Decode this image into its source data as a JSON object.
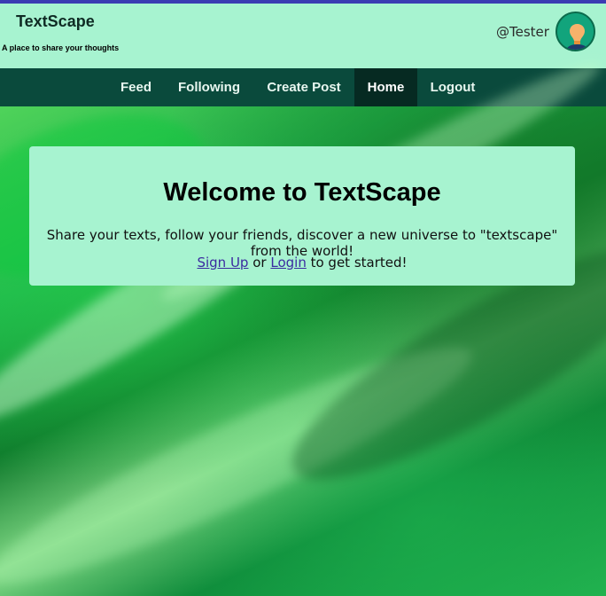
{
  "header": {
    "title": "TextScape",
    "tagline": "A place to share your thoughts",
    "username": "@Tester"
  },
  "nav": {
    "items": [
      {
        "label": "Feed",
        "active": false
      },
      {
        "label": "Following",
        "active": false
      },
      {
        "label": "Create Post",
        "active": false
      },
      {
        "label": "Home",
        "active": true
      },
      {
        "label": "Logout",
        "active": false
      }
    ]
  },
  "welcome": {
    "title": "Welcome to TextScape",
    "subtitle": "Share your texts, follow your friends, discover a new universe to \"textscape\" from the world!",
    "signup_label": "Sign Up",
    "or_text": " or ",
    "login_label": "Login",
    "suffix": " to get started!"
  },
  "colors": {
    "top_border": "#3b3bb3",
    "header_bg": "#a7f3d0",
    "nav_bg": "#0a4a3c",
    "nav_active_bg": "#062a22",
    "link": "#3b2ba0"
  },
  "icons": {
    "avatar": "user-avatar-icon"
  }
}
